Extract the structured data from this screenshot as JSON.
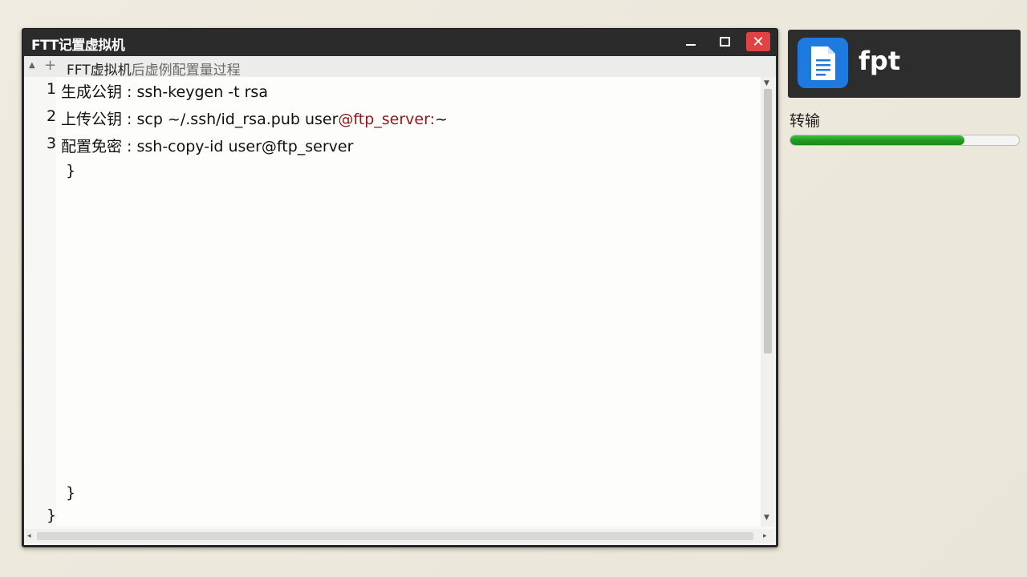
{
  "window": {
    "title": "FTT记置虚拟机",
    "minimize_label": "minimize",
    "maximize_label": "maximize",
    "close_glyph": "✕"
  },
  "breadcrumb": {
    "expand_glyph": "▲",
    "add_glyph": "+",
    "text_main": "FFT虚拟机",
    "text_secondary": "后虚例配置量过程"
  },
  "editor": {
    "lines": [
      {
        "num": "1",
        "label": "生成公钥 : ",
        "code": "ssh-keygen -t rsa",
        "code_red": "",
        "code_tail": ""
      },
      {
        "num": "2",
        "label": "上传公钥 : ",
        "code": "scp ~/.ssh/id_rsa.pub user",
        "code_red": "@ftp_server:",
        "code_tail": "~"
      },
      {
        "num": "3",
        "label": "配置免密 : ",
        "code": "ssh-copy-id user@ftp_server",
        "code_red": "",
        "code_tail": ""
      }
    ],
    "brace_close": "}"
  },
  "notification": {
    "app_label": "fpt",
    "icon": "document-icon",
    "accent": "#1f7ae0"
  },
  "transfer": {
    "label": "转输",
    "progress": 0.76
  }
}
